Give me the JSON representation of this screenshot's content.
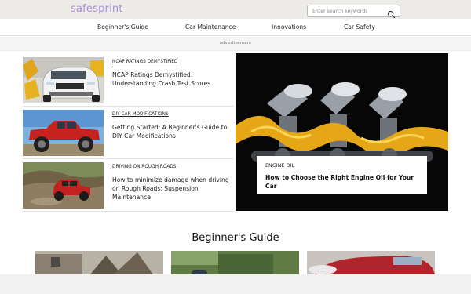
{
  "header": {
    "logo": "safesprint",
    "search_placeholder": "Enter search keywords"
  },
  "nav": {
    "items": [
      "Beginner's Guide",
      "Car Maintenance",
      "Innovations",
      "Car Safety"
    ]
  },
  "ad": {
    "label": "advertisement"
  },
  "articles": [
    {
      "category": "NCAP RATINGS DEMYSTIFIED",
      "title": "NCAP Ratings Demystified: Understanding Crash Test Scores"
    },
    {
      "category": "DIY CAR MODIFICATIONS",
      "title": "Getting Started: A Beginner's Guide to DIY Car Modifications"
    },
    {
      "category": "DRIVING ON ROUGH ROADS",
      "title": "How to minimize damage when driving on Rough Roads: Suspension Maintenance"
    }
  ],
  "feature": {
    "category": "ENGINE OIL",
    "title": "How to Choose the Right Engine Oil for Your Car"
  },
  "section": {
    "title": "Beginner's Guide"
  },
  "icons": {
    "search": "search-icon"
  },
  "colors": {
    "logo": "#a98fd6",
    "topbar": "#ecebe8"
  }
}
